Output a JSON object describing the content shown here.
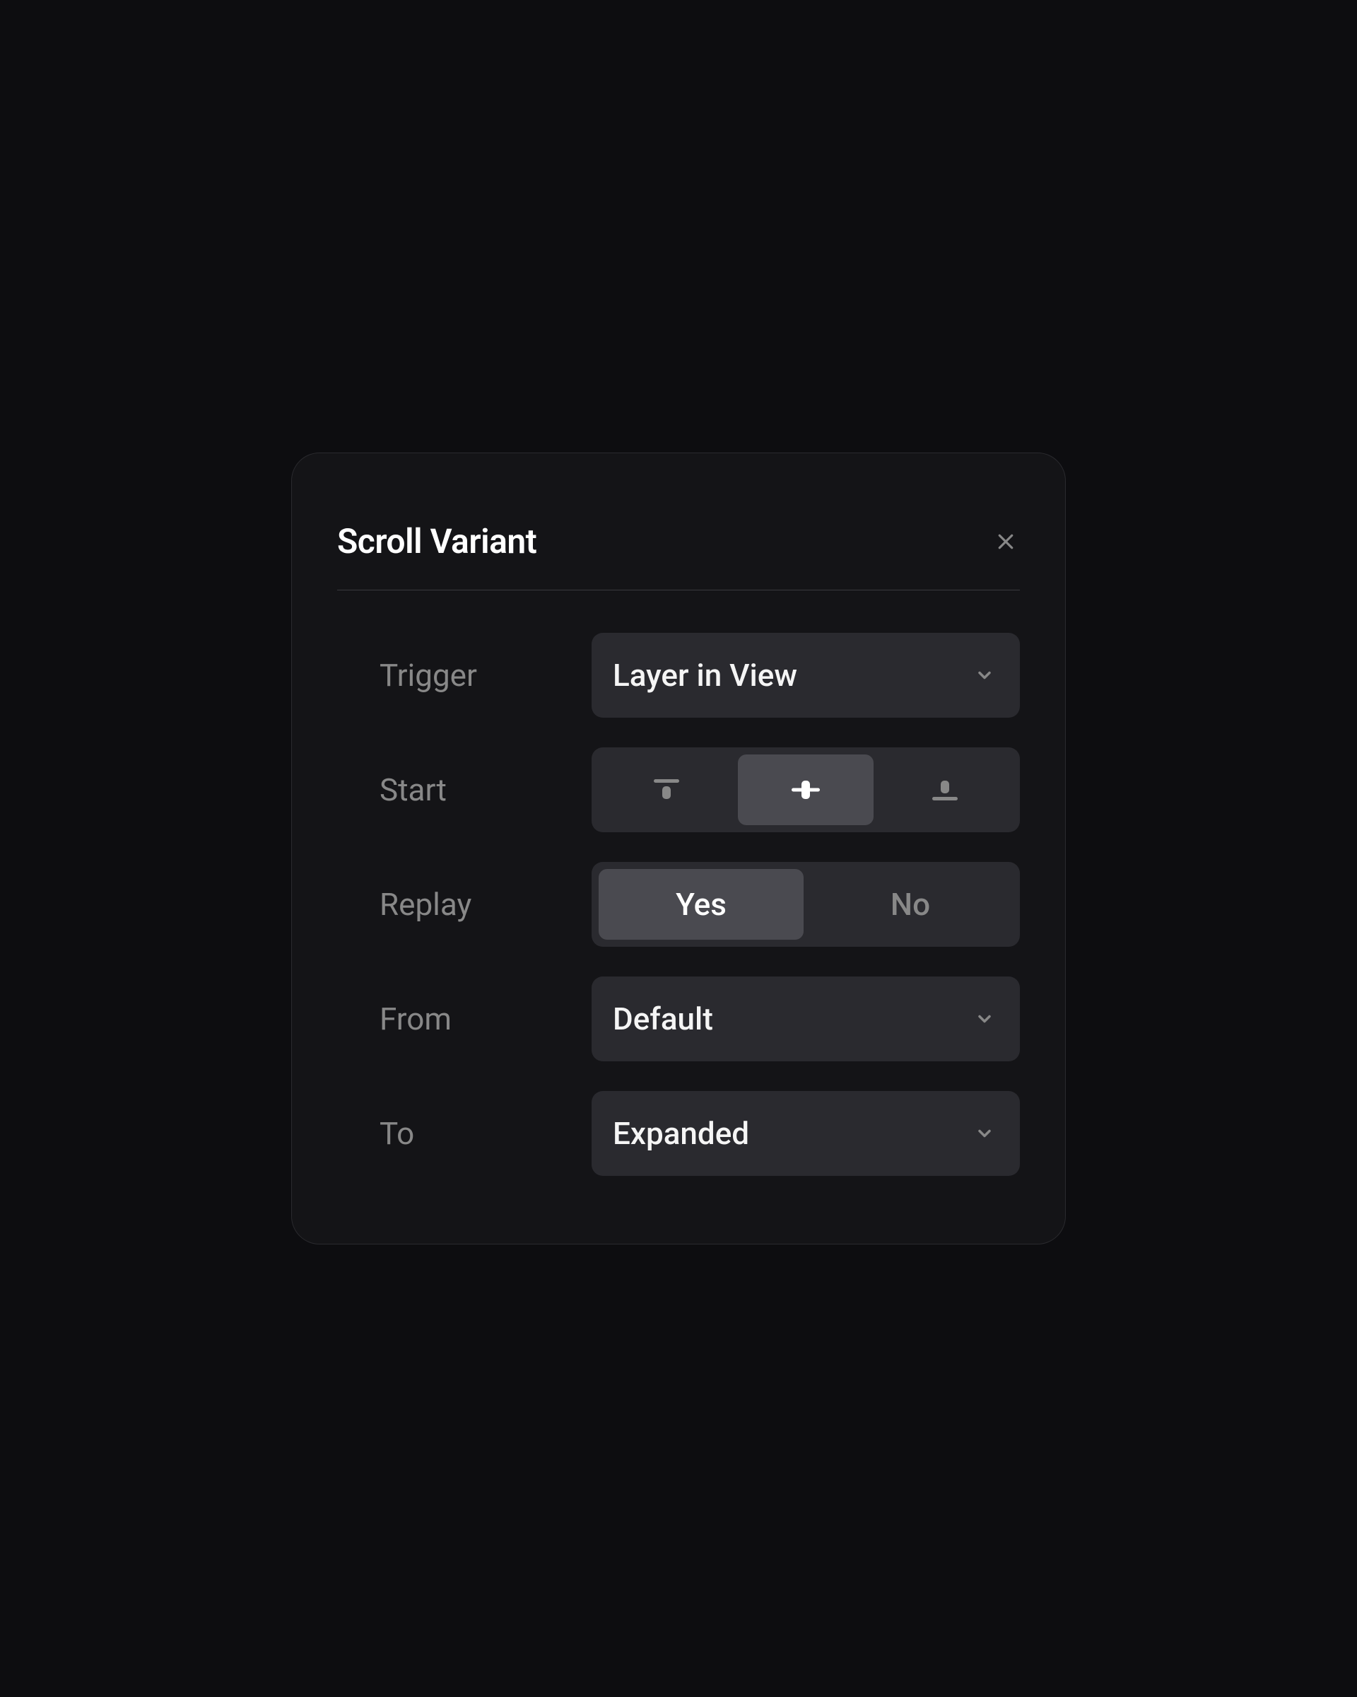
{
  "title": "Scroll Variant",
  "rows": {
    "trigger": {
      "label": "Trigger",
      "value": "Layer in View"
    },
    "start": {
      "label": "Start",
      "selected": "center"
    },
    "replay": {
      "label": "Replay",
      "yes": "Yes",
      "no": "No",
      "selected": "yes"
    },
    "from": {
      "label": "From",
      "value": "Default"
    },
    "to": {
      "label": "To",
      "value": "Expanded"
    }
  }
}
